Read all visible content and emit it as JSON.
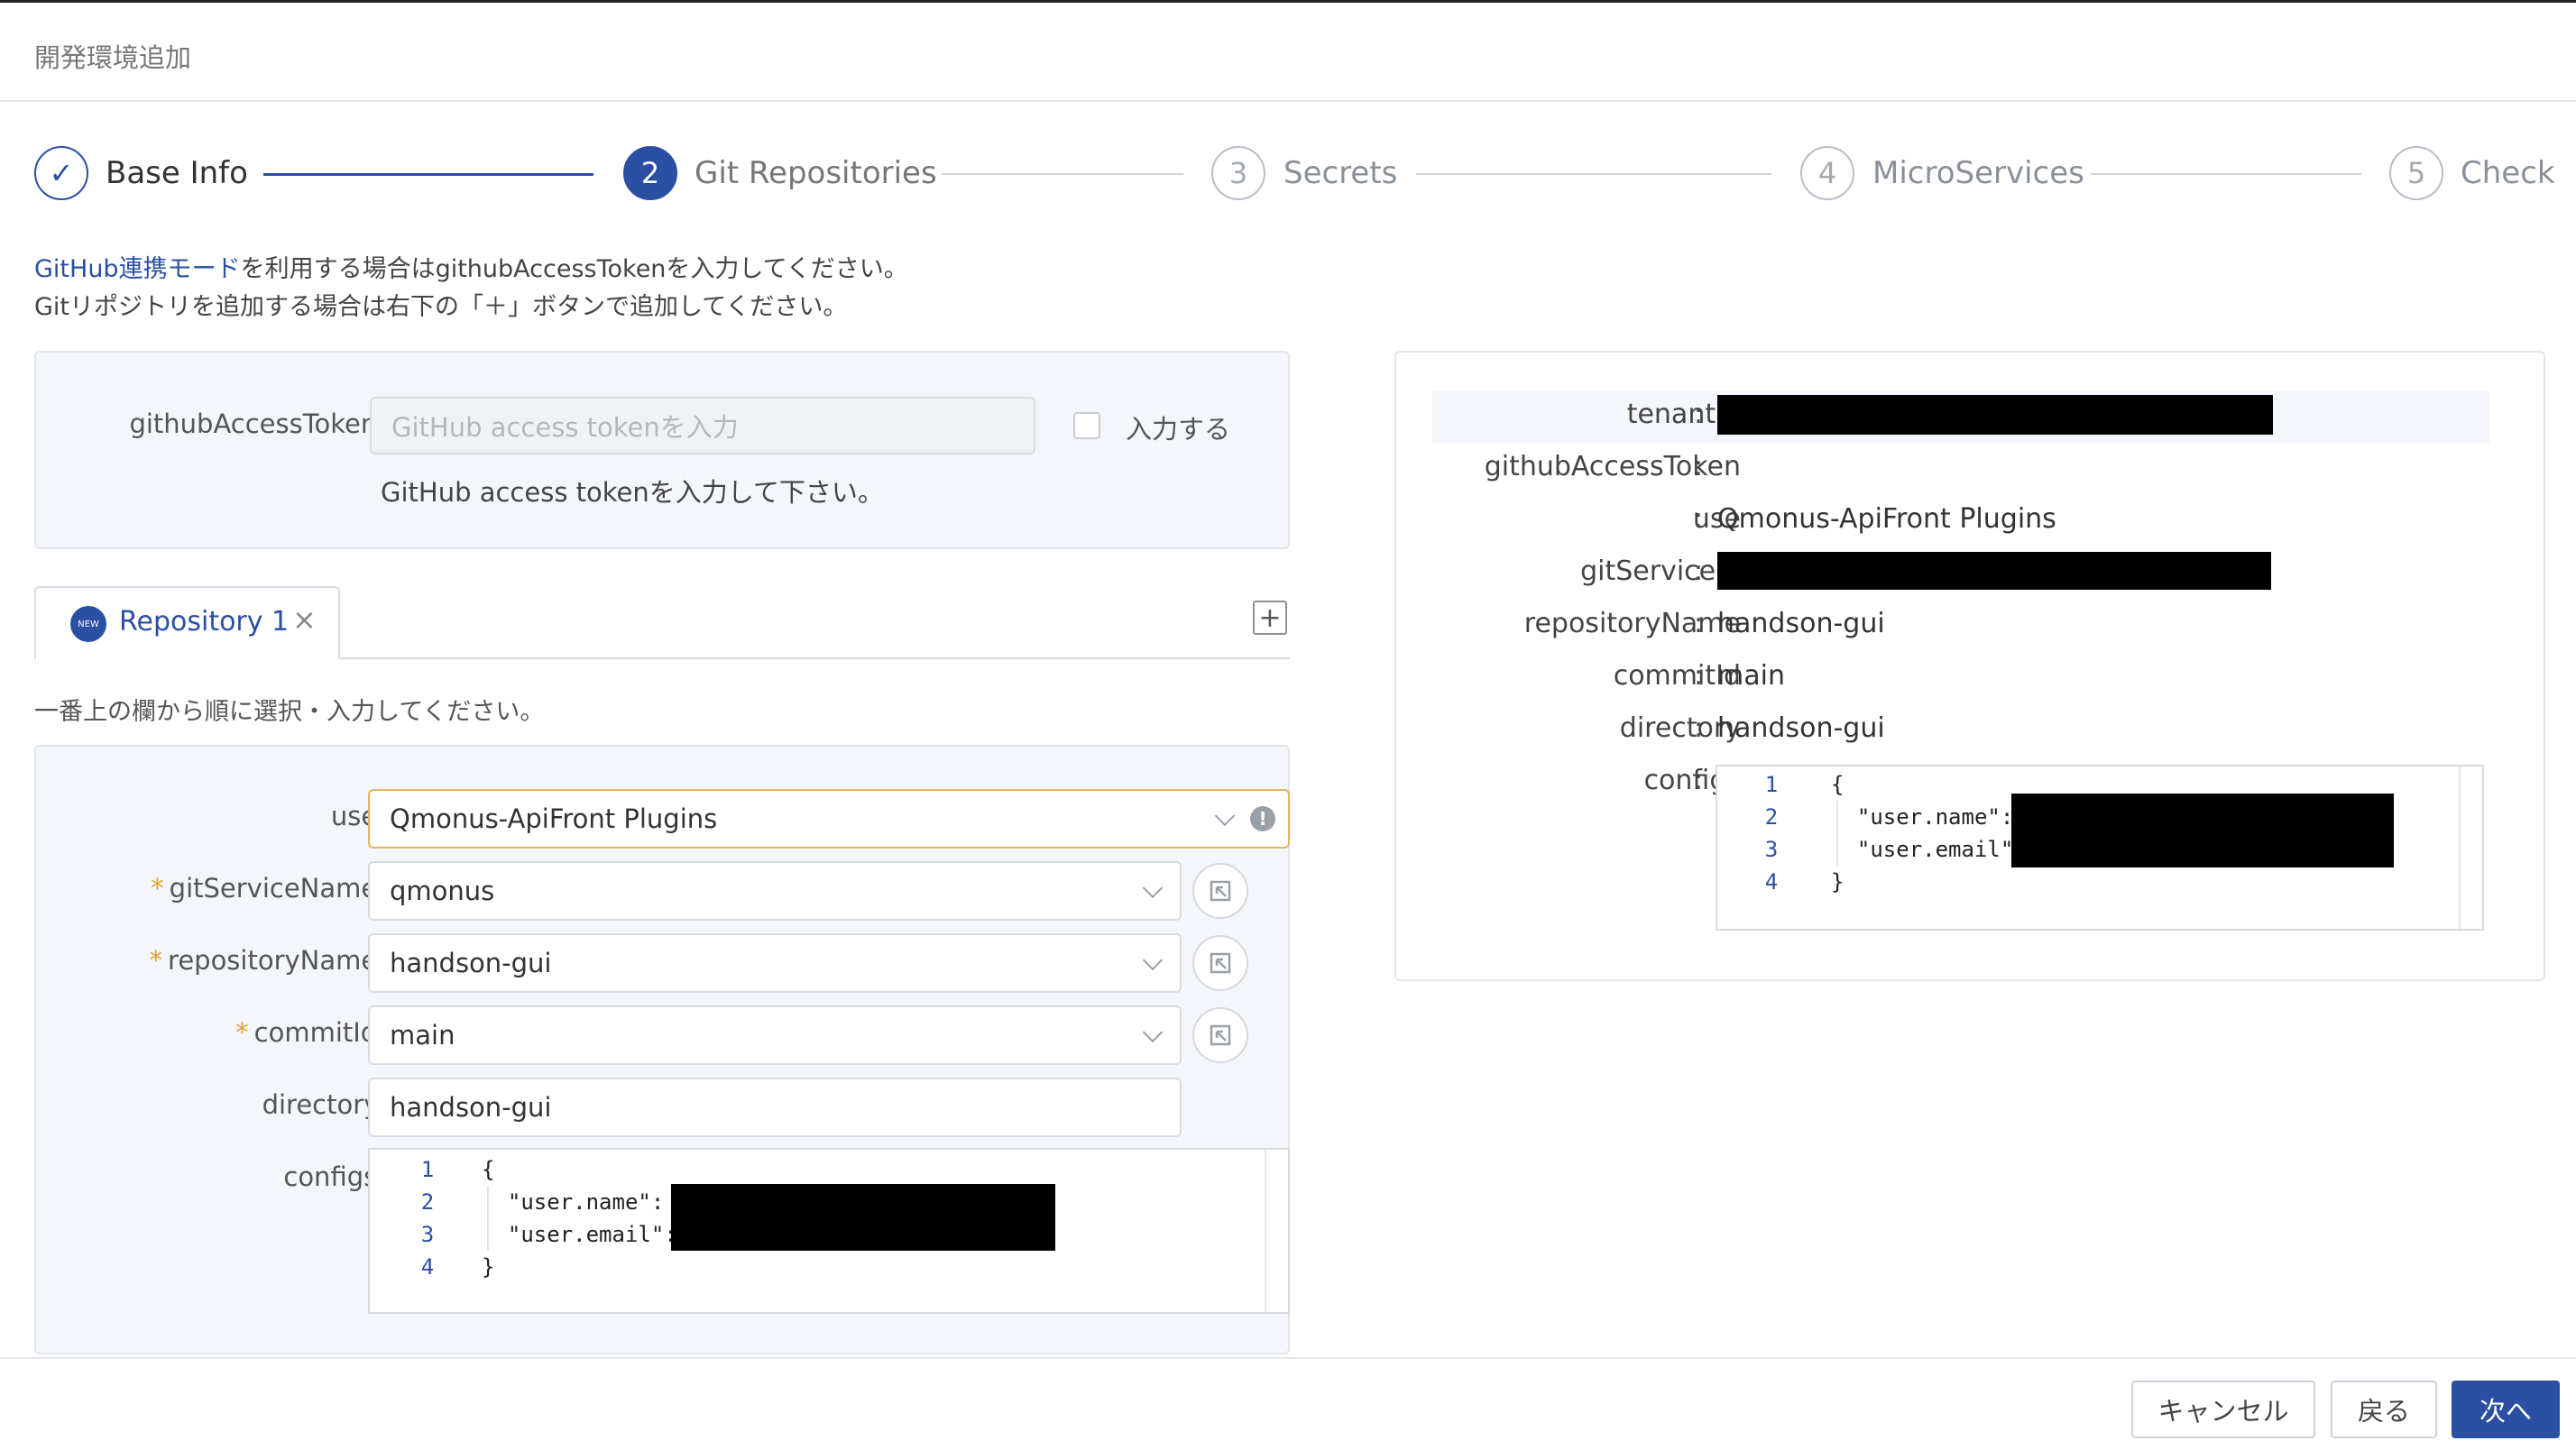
{
  "header": {
    "title": "開発環境追加"
  },
  "stepper": {
    "steps": [
      {
        "number": "✓",
        "label": "Base Info"
      },
      {
        "number": "2",
        "label": "Git Repositories"
      },
      {
        "number": "3",
        "label": "Secrets"
      },
      {
        "number": "4",
        "label": "MicroServices"
      },
      {
        "number": "5",
        "label": "Check"
      }
    ]
  },
  "intro": {
    "link_text": "GitHub連携モード",
    "line1_rest": "を利用する場合はgithubAccessTokenを入力してください。",
    "line2": "Gitリポジトリを追加する場合は右下の「＋」ボタンで追加してください。"
  },
  "token_panel": {
    "label": "githubAccessToken:",
    "placeholder": "GitHub access tokenを入力",
    "checkbox_label": "入力する",
    "help": "GitHub access tokenを入力して下さい。"
  },
  "tabs": {
    "active": {
      "badge": "NEW",
      "label": "Repository 1",
      "close": "×"
    },
    "add": "+"
  },
  "form": {
    "instruction": "一番上の欄から順に選択・入力してください。",
    "use": {
      "label": "use:",
      "value": "Qmonus-ApiFront Plugins"
    },
    "git_service_name": {
      "label": "gitServiceName:",
      "value": "qmonus"
    },
    "repository_name": {
      "label": "repositoryName:",
      "value": "handson-gui"
    },
    "commit_id": {
      "label": "commitId:",
      "value": "main"
    },
    "directory": {
      "label": "directory:",
      "value": "handson-gui"
    },
    "configs": {
      "label": "configs:",
      "line_numbers": [
        "1",
        "2",
        "3",
        "4"
      ],
      "lines": [
        "{",
        "  \"user.name\":",
        "  \"user.email\":",
        "}"
      ]
    }
  },
  "summary": {
    "colon": ":",
    "tenant_id": {
      "label": "tenantId"
    },
    "github_access_token": {
      "label": "githubAccessToken"
    },
    "use": {
      "label": "use",
      "value": "Qmonus-ApiFront Plugins"
    },
    "git_service_id": {
      "label": "gitServiceId"
    },
    "repository_name": {
      "label": "repositoryName",
      "value": "handson-gui"
    },
    "commit_id": {
      "label": "commitId",
      "value": "main"
    },
    "directory": {
      "label": "directory",
      "value": "handson-gui"
    },
    "configs": {
      "label": "configs",
      "line_numbers": [
        "1",
        "2",
        "3",
        "4"
      ],
      "lines": [
        "{",
        "  \"user.name\":",
        "  \"user.email\"",
        "}"
      ]
    }
  },
  "footer": {
    "cancel": "キャンセル",
    "back": "戻る",
    "next": "次へ"
  },
  "colors": {
    "accent": "#2a4fa3",
    "warning_border": "#e6b462",
    "required": "#e0a13a"
  }
}
